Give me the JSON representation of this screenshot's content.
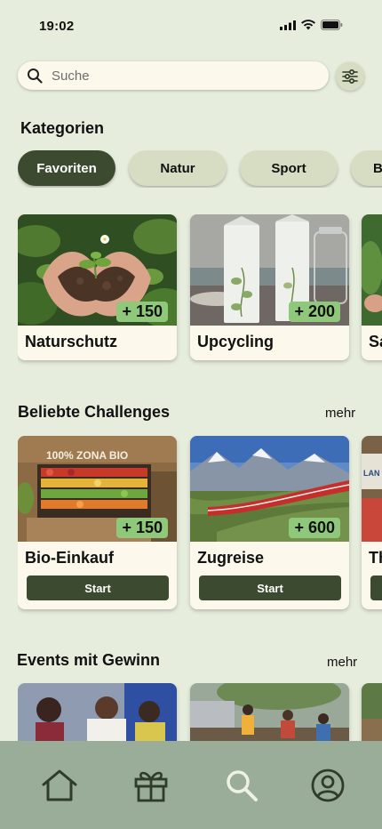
{
  "status": {
    "time": "19:02"
  },
  "search": {
    "placeholder": "Suche"
  },
  "categories_section": {
    "title": "Kategorien",
    "chips": [
      "Favoriten",
      "Natur",
      "Sport",
      "B"
    ]
  },
  "category_cards": [
    {
      "title": "Naturschutz",
      "points": "+ 150"
    },
    {
      "title": "Upcycling",
      "points": "+ 200"
    },
    {
      "title": "Sa"
    }
  ],
  "challenges_section": {
    "title": "Beliebte Challenges",
    "more": "mehr",
    "cards": [
      {
        "title": "Bio-Einkauf",
        "points": "+ 150",
        "button": "Start",
        "sign_text": "100% ZONA BIO"
      },
      {
        "title": "Zugreise",
        "points": "+ 600",
        "button": "Start"
      },
      {
        "title": "Th",
        "sign_text": "LAN"
      }
    ]
  },
  "events_section": {
    "title": "Events mit Gewinn",
    "more": "mehr"
  },
  "nav": [
    "home-icon",
    "gift-icon",
    "search-icon",
    "profile-icon"
  ],
  "colors": {
    "background": "#e7eddd",
    "primary": "#3c4a2f",
    "chip": "#d6ddc3",
    "badge": "#8fc87a",
    "nav_bar": "#99ad98",
    "card": "#fdf8ec"
  }
}
